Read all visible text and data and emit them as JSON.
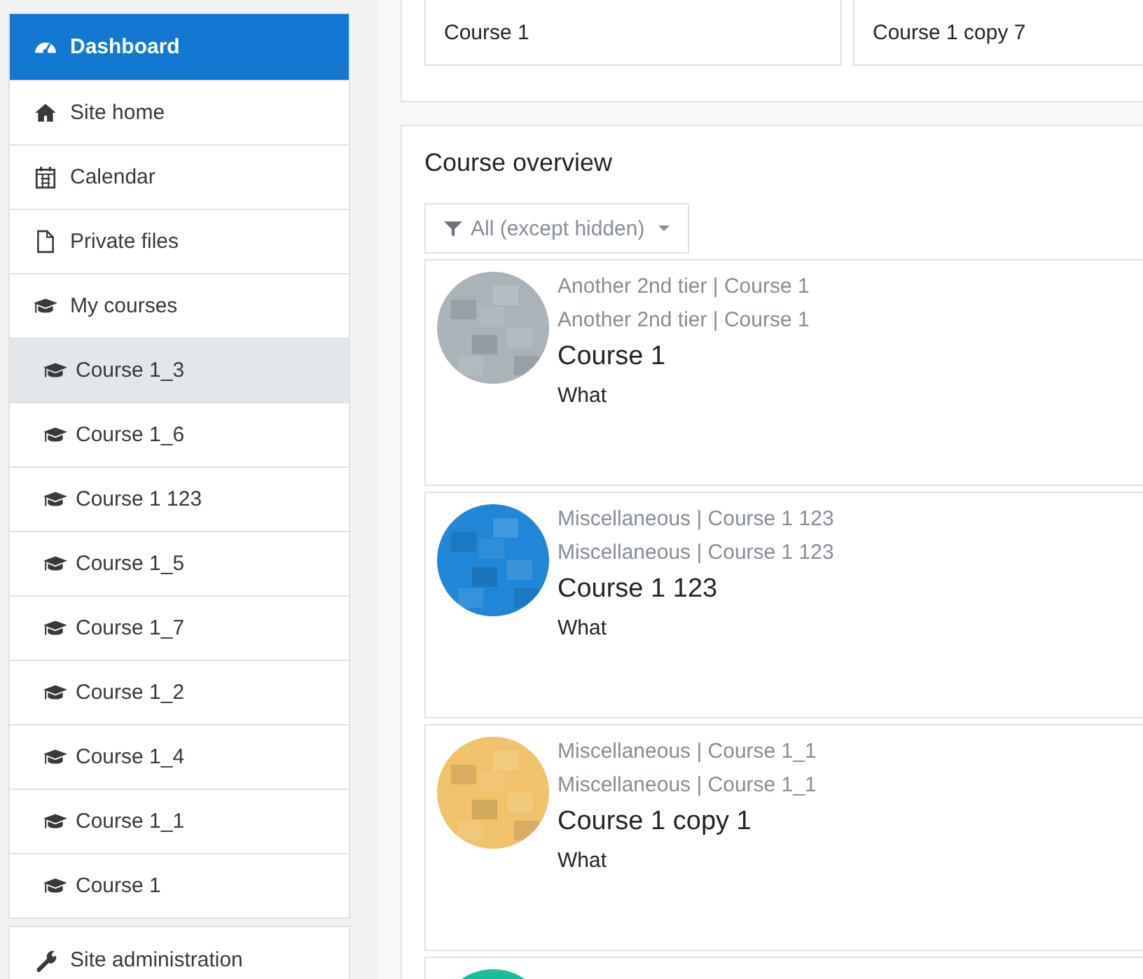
{
  "nav": [
    {
      "label": "Dashboard",
      "kind": "link",
      "selected": true
    },
    {
      "label": "Site home",
      "kind": "link",
      "selected": false
    },
    {
      "label": "Calendar",
      "kind": "link",
      "selected": false
    },
    {
      "label": "Private files",
      "kind": "link",
      "selected": false
    },
    {
      "label": "My courses",
      "kind": "link",
      "selected": false
    },
    {
      "label": "Course 1_3",
      "kind": "course",
      "selected": true
    },
    {
      "label": "Course 1_6",
      "kind": "course",
      "selected": false
    },
    {
      "label": "Course 1 123",
      "kind": "course",
      "selected": false
    },
    {
      "label": "Course 1_5",
      "kind": "course",
      "selected": false
    },
    {
      "label": "Course 1_7",
      "kind": "course",
      "selected": false
    },
    {
      "label": "Course 1_2",
      "kind": "course",
      "selected": false
    },
    {
      "label": "Course 1_4",
      "kind": "course",
      "selected": false
    },
    {
      "label": "Course 1_1",
      "kind": "course",
      "selected": false
    },
    {
      "label": "Course 1",
      "kind": "course",
      "selected": false
    },
    {
      "label": "Site administration",
      "kind": "admin",
      "selected": false
    }
  ],
  "recent": [
    {
      "name": "Course 1"
    },
    {
      "name": "Course 1 copy 7"
    }
  ],
  "overview": {
    "title": "Course overview",
    "filter": "All (except hidden)",
    "courses": [
      {
        "category": "Another 2nd tier | Course 1",
        "category2": "Another 2nd tier | Course 1",
        "name": "Course 1",
        "summary": "What",
        "color": "#a9b3b8"
      },
      {
        "category": "Miscellaneous | Course 1 123",
        "category2": "Miscellaneous | Course 1 123",
        "name": "Course 1 123",
        "summary": "What",
        "color": "#1f86d8"
      },
      {
        "category": "Miscellaneous | Course 1_1",
        "category2": "Miscellaneous | Course 1_1",
        "name": "Course 1 copy 1",
        "summary": "What",
        "color": "#f0c26c"
      },
      {
        "color": "#1abc9c"
      }
    ]
  }
}
